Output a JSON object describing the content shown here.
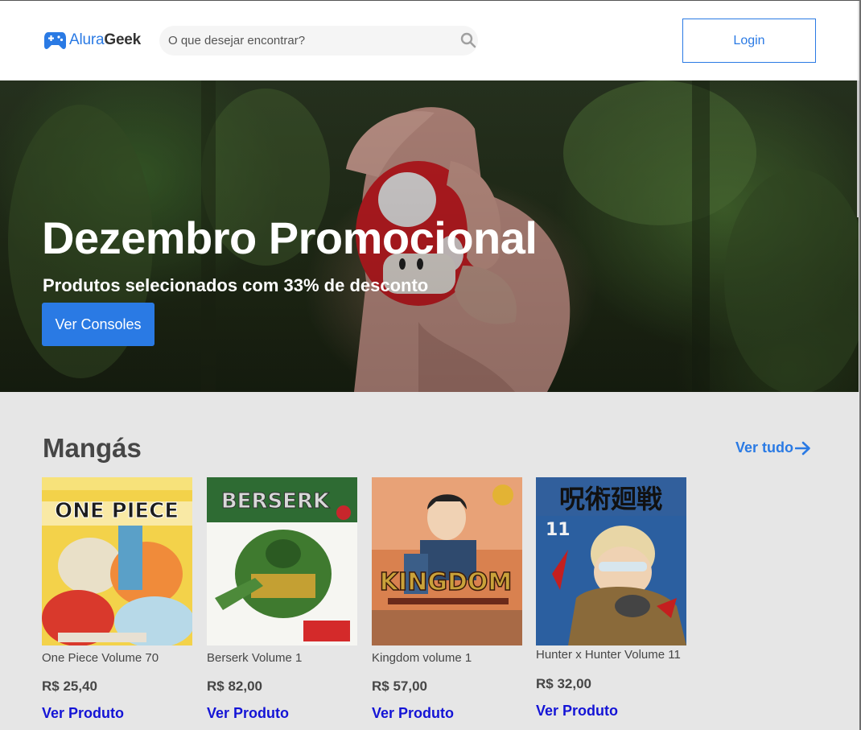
{
  "header": {
    "logo_part1": "Alura",
    "logo_part2": "Geek",
    "search_placeholder": "O que desejar encontrar?",
    "login_label": "Login"
  },
  "hero": {
    "title": "Dezembro Promocional",
    "subtitle": "Produtos selecionados com 33% de desconto",
    "button_label": "Ver Consoles"
  },
  "section": {
    "title": "Mangás",
    "see_all_label": "Ver tudo"
  },
  "products": [
    {
      "name": "One Piece Volume 70",
      "price": "R$ 25,40",
      "link_label": "Ver Produto",
      "cover_text": "ONE PIECE"
    },
    {
      "name": "Berserk Volume 1",
      "price": "R$ 82,00",
      "link_label": "Ver Produto",
      "cover_text": "BERSERK"
    },
    {
      "name": "Kingdom volume 1",
      "price": "R$ 57,00",
      "link_label": "Ver Produto",
      "cover_text": "KINGDOM"
    },
    {
      "name": "Hunter x Hunter Volume 11",
      "price": "R$ 32,00",
      "link_label": "Ver Produto",
      "cover_text": "呪術廻戦"
    }
  ],
  "colors": {
    "brand": "#2a7ae4",
    "link": "#1414d6",
    "text": "#464646",
    "background": "#e6e6e6"
  },
  "icons": {
    "logo": "gamepad-icon",
    "search": "search-icon",
    "see_all": "arrow-right-icon"
  }
}
